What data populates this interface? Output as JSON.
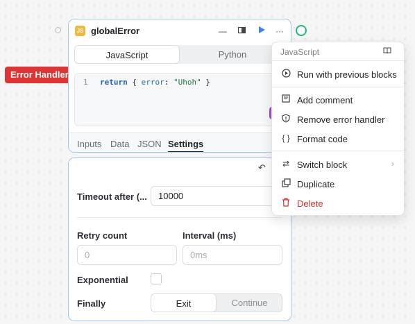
{
  "canvas": {
    "error_tag": "Error Handler"
  },
  "block": {
    "badge": "JS",
    "title": "globalError",
    "header_icons": [
      "minimize-icon",
      "panel-icon",
      "play-icon",
      "more-icon"
    ],
    "languages": [
      {
        "label": "JavaScript",
        "active": true
      },
      {
        "label": "Python",
        "active": false
      }
    ],
    "code": {
      "line_number": "1",
      "keyword": "return",
      "open": " { ",
      "prop": "error",
      "colon": ": ",
      "string": "\"Uhoh\"",
      "close": " }"
    },
    "tabs": [
      {
        "label": "Inputs",
        "active": false
      },
      {
        "label": "Data",
        "active": false
      },
      {
        "label": "JSON",
        "active": false
      },
      {
        "label": "Settings",
        "active": true
      }
    ]
  },
  "settings": {
    "timeout_label": "Timeout after (...",
    "timeout_value": "10000",
    "retry_label": "Retry count",
    "retry_placeholder": "0",
    "interval_label": "Interval (ms)",
    "interval_placeholder": "0ms",
    "exponential_label": "Exponential",
    "finally_label": "Finally",
    "finally_options": [
      {
        "label": "Exit",
        "active": true
      },
      {
        "label": "Continue",
        "active": false
      }
    ]
  },
  "menu": {
    "header": "JavaScript",
    "items": [
      {
        "label": "Run with previous blocks",
        "icon": "play-circle-icon"
      },
      {
        "label": "Add comment",
        "icon": "comment-icon"
      },
      {
        "label": "Remove error handler",
        "icon": "shield-icon"
      },
      {
        "label": "Format code",
        "icon": "braces-icon"
      },
      {
        "label": "Switch block",
        "icon": "switch-icon"
      },
      {
        "label": "Duplicate",
        "icon": "duplicate-icon"
      },
      {
        "label": "Delete",
        "icon": "trash-icon"
      }
    ]
  },
  "colors": {
    "accent": "#3b82f6",
    "selection_border": "#9fc7ef",
    "error": "#e03434",
    "success": "#22b573",
    "danger_text": "#d32f2f"
  }
}
